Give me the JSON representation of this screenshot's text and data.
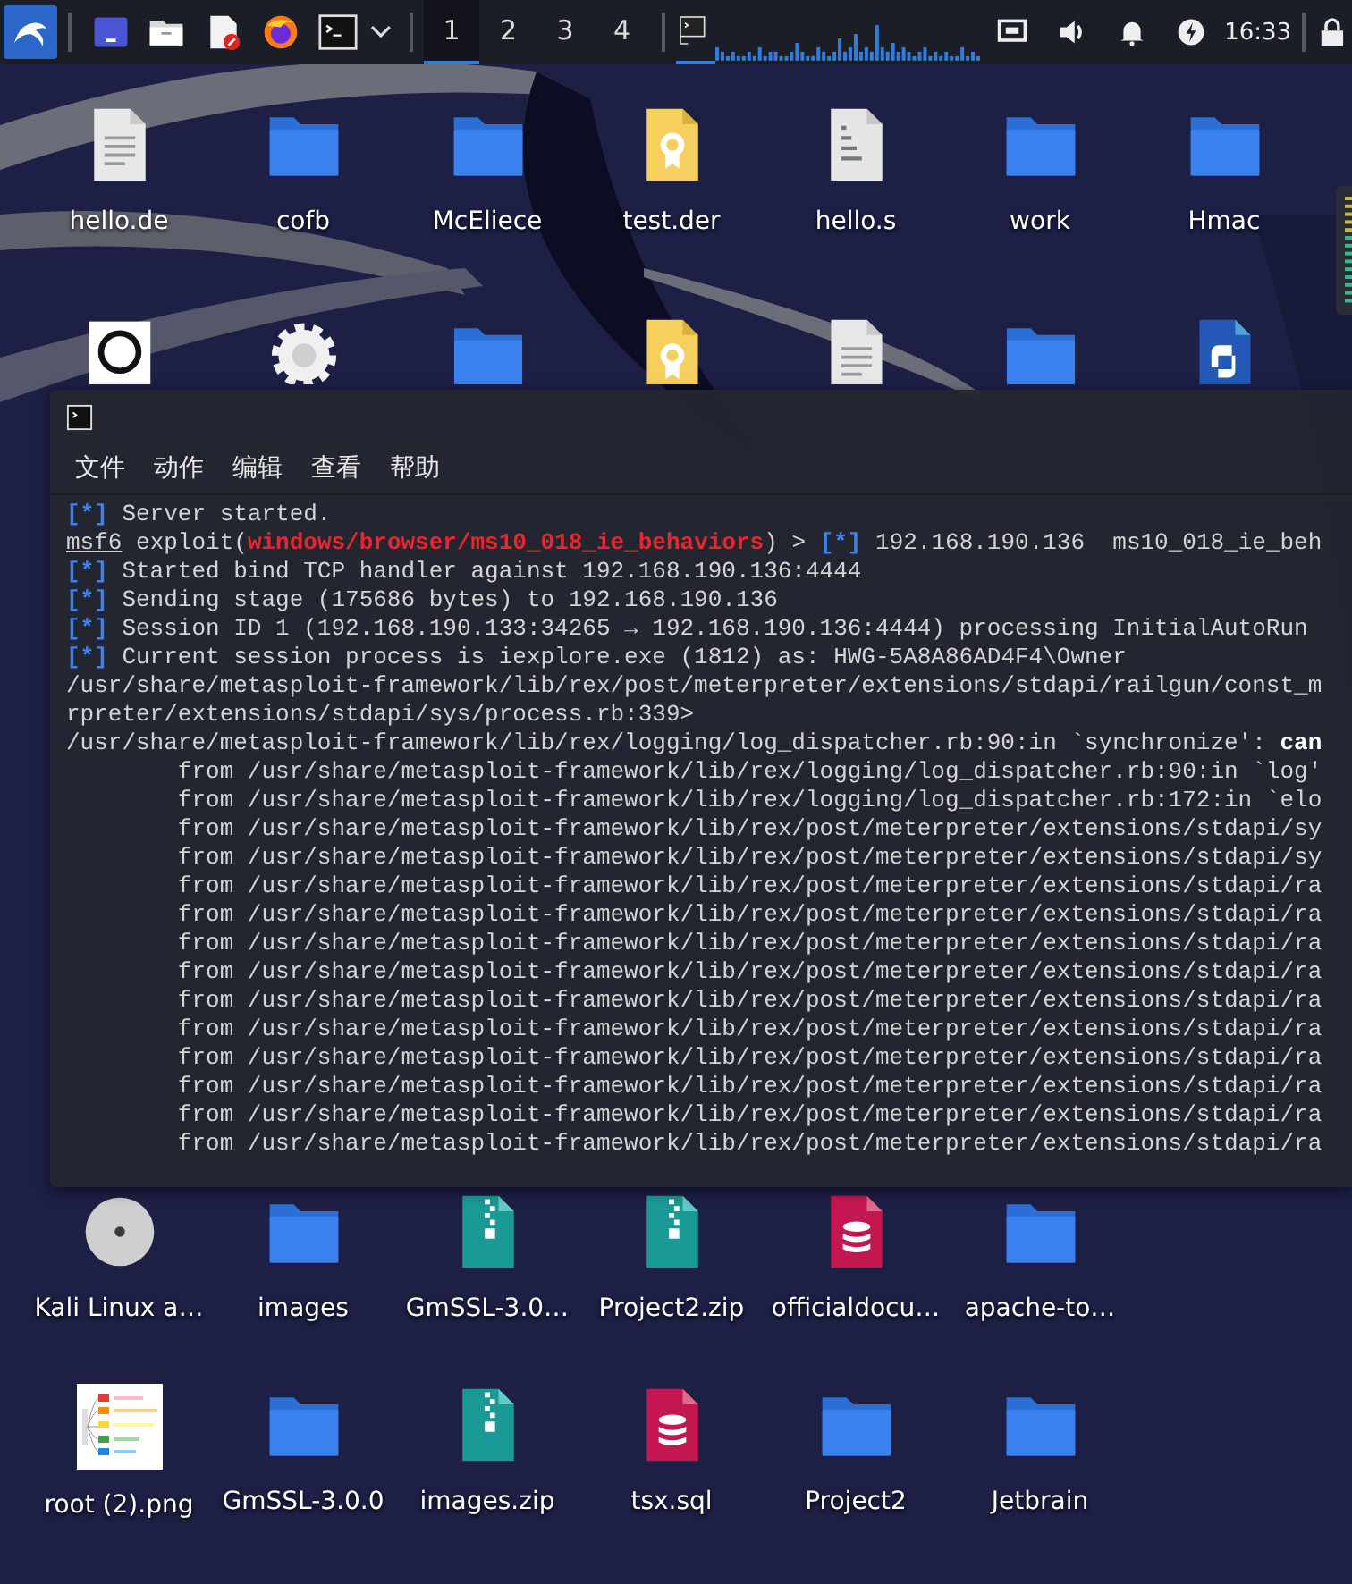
{
  "panel": {
    "launchers": [
      {
        "kind": "menu"
      },
      {
        "kind": "desktop"
      },
      {
        "kind": "files"
      },
      {
        "kind": "editor"
      },
      {
        "kind": "browser"
      },
      {
        "kind": "terminal"
      },
      {
        "kind": "caret"
      }
    ],
    "workspaces": [
      {
        "label": "1",
        "selected": true
      },
      {
        "label": "2",
        "selected": false
      },
      {
        "label": "3",
        "selected": false
      },
      {
        "label": "4",
        "selected": false
      }
    ],
    "tasks": [
      {
        "kind": "terminal",
        "selected": true
      }
    ],
    "tray": [
      {
        "kind": "network"
      },
      {
        "kind": "volume"
      },
      {
        "kind": "bell"
      },
      {
        "kind": "power"
      }
    ],
    "clock": "16:33"
  },
  "desktop": {
    "rows": [
      [
        {
          "kind": "document",
          "label": "hello.de"
        },
        {
          "kind": "folder",
          "label": "cofb"
        },
        {
          "kind": "folder",
          "label": "McEliece"
        },
        {
          "kind": "certificate",
          "label": "test.der"
        },
        {
          "kind": "binary",
          "label": "hello.s"
        },
        {
          "kind": "folder",
          "label": "work"
        },
        {
          "kind": "folder",
          "label": "Hmac"
        }
      ],
      [
        {
          "kind": "ring"
        },
        {
          "kind": "gear"
        },
        {
          "kind": "folder"
        },
        {
          "kind": "certificate"
        },
        {
          "kind": "document"
        },
        {
          "kind": "folder"
        },
        {
          "kind": "python"
        }
      ],
      [
        {
          "kind": "disc",
          "label": "Kali Linux a…"
        },
        {
          "kind": "folder",
          "label": "images"
        },
        {
          "kind": "zip",
          "label": "GmSSL-3.0…"
        },
        {
          "kind": "zip",
          "label": "Project2.zip"
        },
        {
          "kind": "database",
          "label": "officialdocu…"
        },
        {
          "kind": "folder",
          "label": "apache-to…"
        }
      ],
      [
        {
          "label": "root (2).png"
        },
        {
          "kind": "folder",
          "label": "GmSSL-3.0.0"
        },
        {
          "kind": "zip",
          "label": "images.zip"
        },
        {
          "kind": "database",
          "label": "tsx.sql"
        },
        {
          "kind": "folder",
          "label": "Project2"
        },
        {
          "kind": "folder",
          "label": "Jetbrain"
        }
      ]
    ]
  },
  "terminal": {
    "menu": [
      "文件",
      "动作",
      "编辑",
      "查看",
      "帮助"
    ],
    "lines": [
      [
        {
          "kind": "marker",
          "text": "[*]"
        },
        {
          "kind": "plain",
          "text": " Server started."
        }
      ],
      [
        {
          "kind": "prompt",
          "text": "msf6"
        },
        {
          "kind": "plain",
          "text": " exploit("
        },
        {
          "kind": "module",
          "text": "windows/browser/ms10_018_ie_behaviors"
        },
        {
          "kind": "plain",
          "text": ") > "
        },
        {
          "kind": "marker",
          "text": "[*]"
        },
        {
          "kind": "plain",
          "text": " 192.168.190.136  ms10_018_ie_beh"
        }
      ],
      [
        {
          "kind": "marker",
          "text": "[*]"
        },
        {
          "kind": "plain",
          "text": " Started bind TCP handler against 192.168.190.136:4444"
        }
      ],
      [
        {
          "kind": "marker",
          "text": "[*]"
        },
        {
          "kind": "plain",
          "text": " Sending stage (175686 bytes) to 192.168.190.136"
        }
      ],
      [
        {
          "kind": "marker",
          "text": "[*]"
        },
        {
          "kind": "plain",
          "text": " Session ID 1 (192.168.190.133:34265 → 192.168.190.136:4444) processing InitialAutoRun"
        }
      ],
      [
        {
          "kind": "marker",
          "text": "[*]"
        },
        {
          "kind": "plain",
          "text": " Current session process is iexplore.exe (1812) as: HWG-5A8A86AD4F4\\Owner"
        }
      ],
      [
        {
          "kind": "plain",
          "text": "/usr/share/metasploit-framework/lib/rex/post/meterpreter/extensions/stdapi/railgun/const_m"
        }
      ],
      [
        {
          "kind": "plain",
          "text": "rpreter/extensions/stdapi/sys/process.rb:339>"
        }
      ],
      [
        {
          "kind": "plain",
          "text": "/usr/share/metasploit-framework/lib/rex/logging/log_dispatcher.rb:90:in `synchronize': **can**"
        }
      ],
      [
        {
          "kind": "plain",
          "text": "        from /usr/share/metasploit-framework/lib/rex/logging/log_dispatcher.rb:90:in `log'"
        }
      ],
      [
        {
          "kind": "plain",
          "text": "        from /usr/share/metasploit-framework/lib/rex/logging/log_dispatcher.rb:172:in `elo"
        }
      ],
      [
        {
          "kind": "plain",
          "text": "        from /usr/share/metasploit-framework/lib/rex/post/meterpreter/extensions/stdapi/sy"
        }
      ],
      [
        {
          "kind": "plain",
          "text": "        from /usr/share/metasploit-framework/lib/rex/post/meterpreter/extensions/stdapi/sy"
        }
      ],
      [
        {
          "kind": "plain",
          "text": "        from /usr/share/metasploit-framework/lib/rex/post/meterpreter/extensions/stdapi/ra"
        }
      ],
      [
        {
          "kind": "plain",
          "text": "        from /usr/share/metasploit-framework/lib/rex/post/meterpreter/extensions/stdapi/ra"
        }
      ],
      [
        {
          "kind": "plain",
          "text": "        from /usr/share/metasploit-framework/lib/rex/post/meterpreter/extensions/stdapi/ra"
        }
      ],
      [
        {
          "kind": "plain",
          "text": "        from /usr/share/metasploit-framework/lib/rex/post/meterpreter/extensions/stdapi/ra"
        }
      ],
      [
        {
          "kind": "plain",
          "text": "        from /usr/share/metasploit-framework/lib/rex/post/meterpreter/extensions/stdapi/ra"
        }
      ],
      [
        {
          "kind": "plain",
          "text": "        from /usr/share/metasploit-framework/lib/rex/post/meterpreter/extensions/stdapi/ra"
        }
      ],
      [
        {
          "kind": "plain",
          "text": "        from /usr/share/metasploit-framework/lib/rex/post/meterpreter/extensions/stdapi/ra"
        }
      ],
      [
        {
          "kind": "plain",
          "text": "        from /usr/share/metasploit-framework/lib/rex/post/meterpreter/extensions/stdapi/ra"
        }
      ],
      [
        {
          "kind": "plain",
          "text": "        from /usr/share/metasploit-framework/lib/rex/post/meterpreter/extensions/stdapi/ra"
        }
      ],
      [
        {
          "kind": "plain",
          "text": "        from /usr/share/metasploit-framework/lib/rex/post/meterpreter/extensions/stdapi/ra"
        }
      ]
    ]
  }
}
